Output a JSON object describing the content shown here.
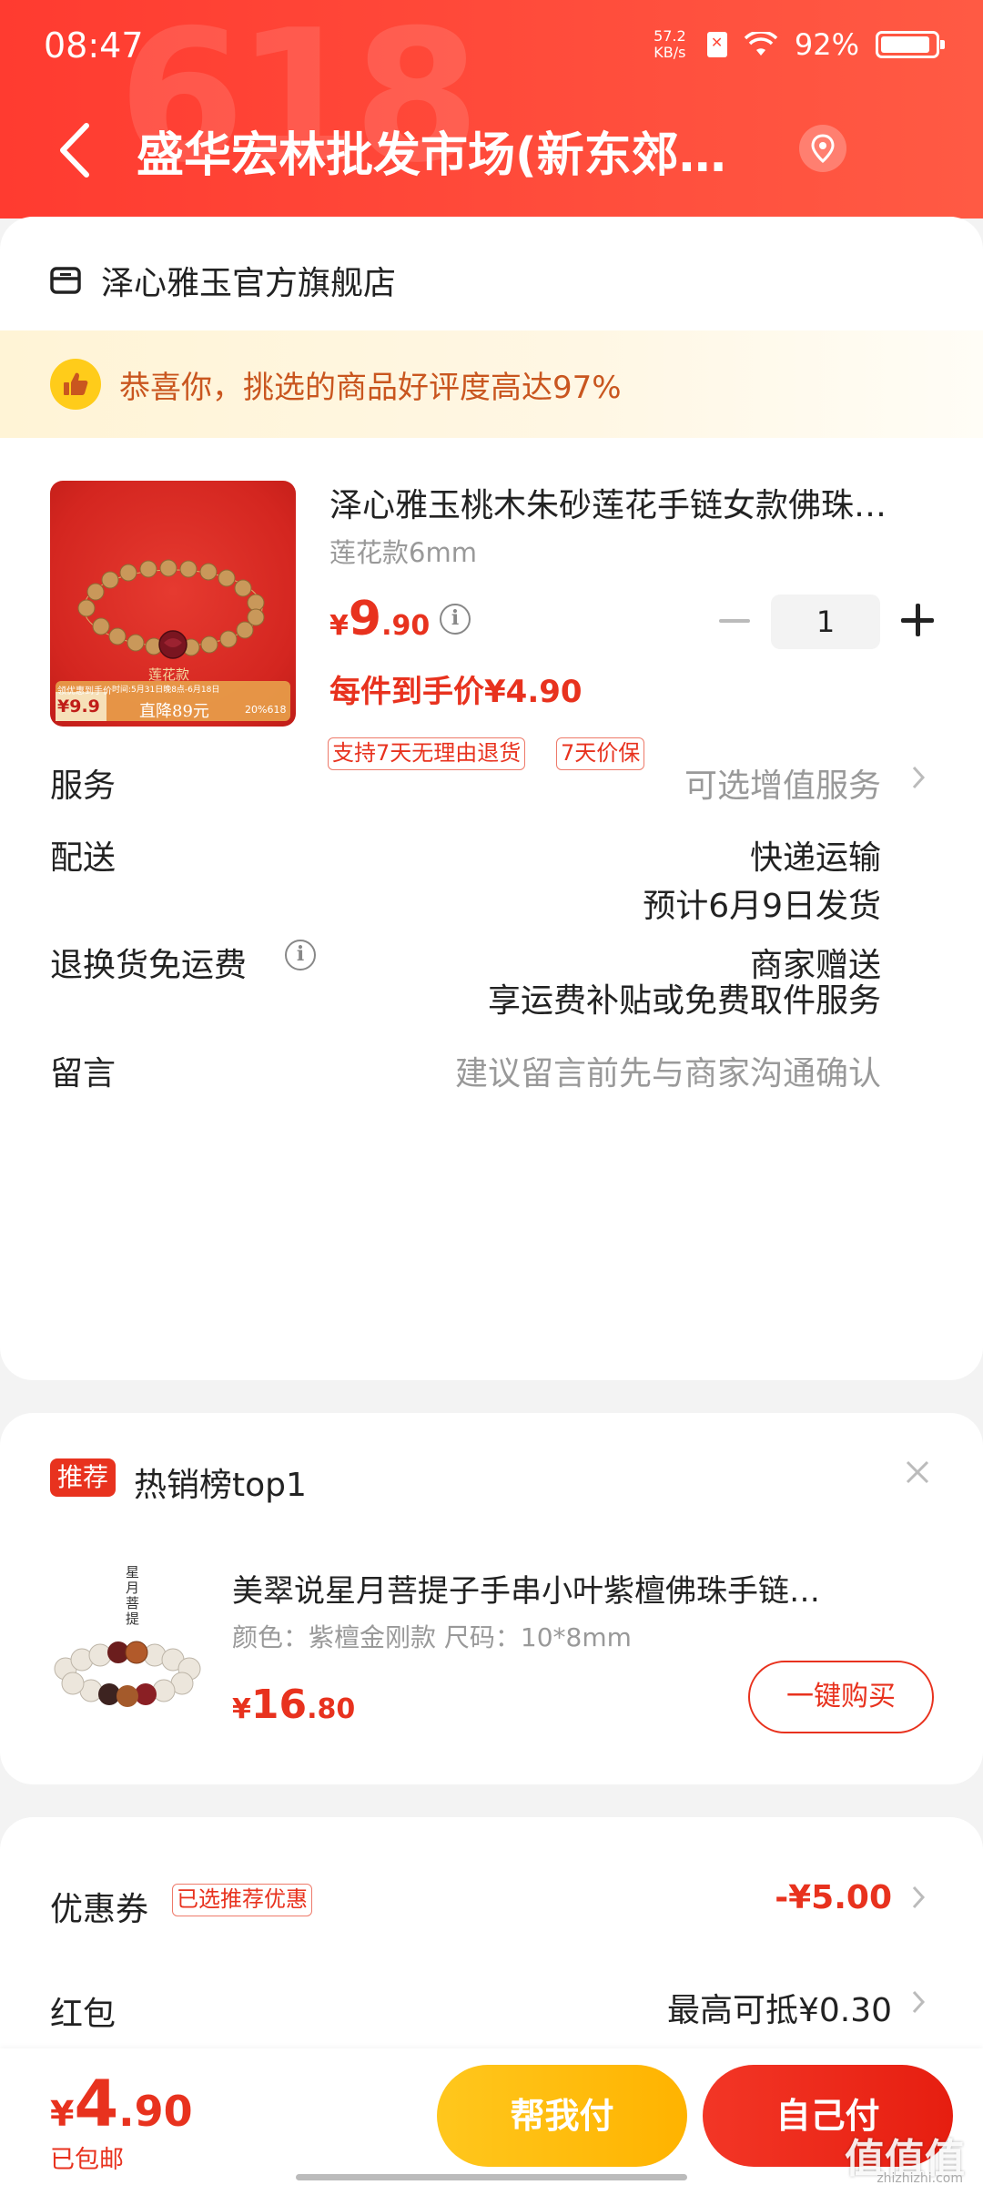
{
  "status_bar": {
    "time": "08:47",
    "net_speed_top": "57.2",
    "net_speed_bottom": "KB/s",
    "battery": "92%"
  },
  "nav": {
    "title": "盛华宏林批发市场(新东郊…",
    "bg_text": "618"
  },
  "shop": {
    "name": "泽心雅玉官方旗舰店"
  },
  "praise": {
    "text": "恭喜你，挑选的商品好评度高达97%"
  },
  "product": {
    "title": "泽心雅玉桃木朱砂莲花手链女款佛珠…",
    "spec": "莲花款6mm",
    "price_yen": "¥",
    "price_int": "9",
    "price_dec": ".90",
    "each_price": "每件到手价¥4.90",
    "quantity": "1",
    "tags": [
      "支持7天无理由退货",
      "7天价保"
    ],
    "image_text": {
      "style": "莲花款",
      "promo_label": "领优惠到手价",
      "promo_price": "¥9.9",
      "promo_time": "时间:5月31日晚8点-6月18日",
      "promo_drop": "直降89元",
      "promo_corner": "20%618"
    }
  },
  "rows": {
    "service_label": "服务",
    "service_value": "可选增值服务",
    "delivery_label": "配送",
    "delivery_value1": "快递运输",
    "delivery_value2": "预计6月9日发货",
    "return_label": "退换货免运费",
    "return_value1": "商家赠送",
    "return_value2": "享运费补贴或免费取件服务",
    "message_label": "留言",
    "message_placeholder": "建议留言前先与商家沟通确认"
  },
  "recommend": {
    "badge": "推荐",
    "title": "热销榜top1",
    "product_title": "美翠说星月菩提子手串小叶紫檀佛珠手链…",
    "spec": "颜色：紫檀金刚款   尺码：10*8mm",
    "price_yen": "¥",
    "price_int": "16",
    "price_dec": ".80",
    "buy_label": "一键购买",
    "image_text": "星月菩提"
  },
  "discounts": {
    "coupon_label": "优惠券",
    "coupon_tag": "已选推荐优惠",
    "coupon_value": "-¥5.00",
    "redpack_label": "红包",
    "redpack_value": "最高可抵¥0.30"
  },
  "bottom": {
    "total_yen": "¥",
    "total_int": "4",
    "total_dec": ".90",
    "free_ship": "已包邮",
    "help_pay": "帮我付",
    "self_pay": "自己付",
    "watermark": "值值值",
    "watermark_sub": "zhizhizhi.com"
  },
  "colors": {
    "accent_red": "#e8321e",
    "header_red": "#ff3b30",
    "help_pay_yellow": "#ffc71d",
    "praise_text": "#c9561f"
  },
  "icons": {
    "back": "back-arrow-icon",
    "location": "location-pin-icon",
    "shop": "shop-icon",
    "thumb": "thumb-up-icon",
    "info": "info-icon",
    "chevron": "chevron-right-icon",
    "close": "close-icon"
  }
}
